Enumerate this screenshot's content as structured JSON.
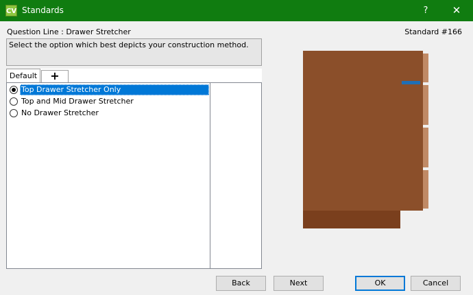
{
  "window": {
    "icon_text": "CV",
    "title": "Standards",
    "help_glyph": "?",
    "close_glyph": "✕"
  },
  "header": {
    "question_line": "Question Line : Drawer Stretcher",
    "standard_number": "Standard #166"
  },
  "instruction": "Select the option which best depicts your construction method.",
  "tabs": [
    {
      "label": "Default"
    },
    {
      "label": "+"
    }
  ],
  "options": [
    {
      "label": "Top Drawer Stretcher Only",
      "selected": true
    },
    {
      "label": "Top and Mid Drawer Stretcher",
      "selected": false
    },
    {
      "label": "No Drawer Stretcher",
      "selected": false
    }
  ],
  "buttons": {
    "back": "Back",
    "next": "Next",
    "ok": "OK",
    "cancel": "Cancel"
  },
  "colors": {
    "titlebar": "#107c10",
    "selection": "#0078d7",
    "cabinet_body": "#8b4f2a",
    "cabinet_base": "#7a3f1d",
    "door_edge": "#c08a66",
    "stretcher": "#1f6fb5"
  }
}
